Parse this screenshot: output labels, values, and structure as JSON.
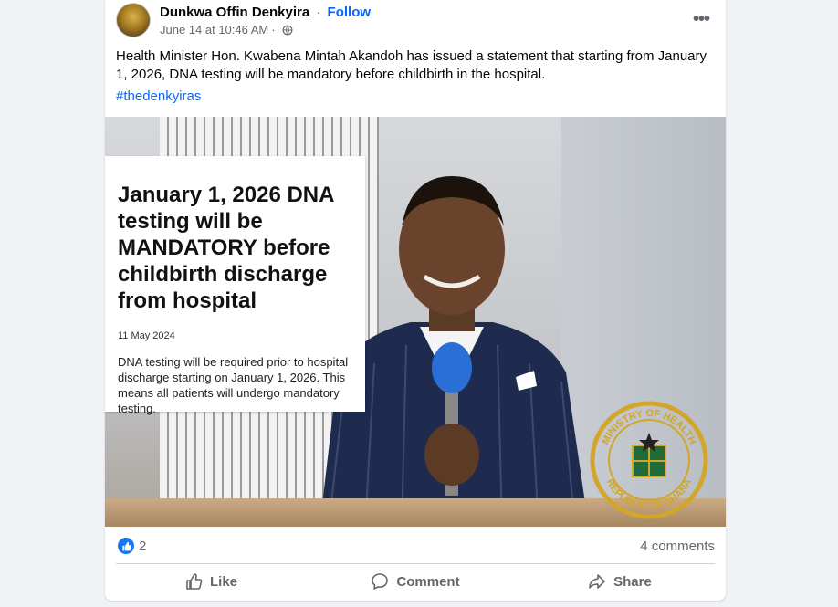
{
  "post": {
    "page_name": "Dunkwa Offin Denkyira",
    "separator": "·",
    "follow_label": "Follow",
    "timestamp": "June 14 at 10:46 AM",
    "meta_separator": "·",
    "audience_icon": "globe-icon",
    "more_label": "•••",
    "text": "Health Minister Hon. Kwabena Mintah Akandoh has issued a statement that starting from January 1, 2026, DNA testing will be mandatory before childbirth in the hospital.",
    "hashtag": "#thedenkyiras"
  },
  "image": {
    "headline": "January 1, 2026 DNA testing will be MANDATORY before childbirth discharge from hospital",
    "date": "11 May 2024",
    "body": "DNA testing will be required prior to hospital discharge starting on January 1, 2026. This means all patients will undergo mandatory testing.",
    "seal_top_text": "MINISTRY OF HEALTH",
    "seal_bottom_text": "REPUBLIC OF GHANA"
  },
  "stats": {
    "reaction_icon": "like-icon",
    "reaction_count": "2",
    "comments": "4 comments"
  },
  "actions": [
    {
      "label": "Like",
      "icon": "thumbs-up-icon"
    },
    {
      "label": "Comment",
      "icon": "speech-bubble-icon"
    },
    {
      "label": "Share",
      "icon": "share-arrow-icon"
    }
  ],
  "colors": {
    "accent": "#0866ff",
    "like_blue": "#1877f2",
    "secondary_text": "#65676b",
    "page_bg": "#f0f2f5"
  }
}
